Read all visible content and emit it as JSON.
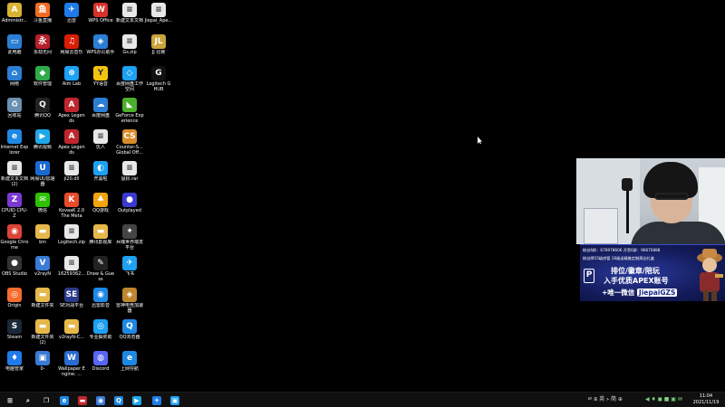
{
  "desktop": {
    "icons": [
      {
        "label": "Administr...",
        "glyph": "A",
        "color": "#d9b233"
      },
      {
        "label": "此电脑",
        "glyph": "▭",
        "color": "#2a7fd4"
      },
      {
        "label": "网络",
        "glyph": "⌂",
        "color": "#2a7fd4"
      },
      {
        "label": "回收站",
        "glyph": "♻",
        "color": "#6a8fb0"
      },
      {
        "label": "Internet Explorer",
        "glyph": "e",
        "color": "#1e88e5"
      },
      {
        "label": "新建文本文档 (2)",
        "glyph": "≡",
        "color": "#e8e8e8"
      },
      {
        "label": "CPUID CPU-Z",
        "glyph": "Z",
        "color": "#7a3ad1"
      },
      {
        "label": "Google Chrome",
        "glyph": "◉",
        "color": "#db4437"
      },
      {
        "label": "OBS Studio",
        "glyph": "●",
        "color": "#333333"
      },
      {
        "label": "Origin",
        "glyph": "◎",
        "color": "#f56c2d"
      },
      {
        "label": "Steam",
        "glyph": "S",
        "color": "#1b2838"
      },
      {
        "label": "电脑管家",
        "glyph": "♦",
        "color": "#1e7be8"
      },
      {
        "label": "斗鱼直播",
        "glyph": "鱼",
        "color": "#f26b21"
      },
      {
        "label": "永劫无间",
        "glyph": "永",
        "color": "#b5202a"
      },
      {
        "label": "软件管理",
        "glyph": "◆",
        "color": "#2eaa4a"
      },
      {
        "label": "腾讯QQ",
        "glyph": "Q",
        "color": "#222222"
      },
      {
        "label": "腾讯视频",
        "glyph": "▶",
        "color": "#1fa7e9"
      },
      {
        "label": "网易UU加速器",
        "glyph": "U",
        "color": "#1a6ad1"
      },
      {
        "label": "微信",
        "glyph": "✉",
        "color": "#2dc100"
      },
      {
        "label": "bin",
        "glyph": "▬",
        "color": "#e6b84a"
      },
      {
        "label": "v2rayN",
        "glyph": "V",
        "color": "#3a7bd5"
      },
      {
        "label": "新建文件夹",
        "glyph": "▬",
        "color": "#e6b84a"
      },
      {
        "label": "新建文件夹 (2)",
        "glyph": "▬",
        "color": "#e6b84a"
      },
      {
        "label": "0-",
        "glyph": "▣",
        "color": "#3a7bd5"
      },
      {
        "label": "迅雷",
        "glyph": "✈",
        "color": "#1e7be8"
      },
      {
        "label": "网易云音乐",
        "glyph": "♫",
        "color": "#d81e06"
      },
      {
        "label": "Aim Lab",
        "glyph": "⊕",
        "color": "#1da1f2"
      },
      {
        "label": "Apex Legends",
        "glyph": "A",
        "color": "#c0262d"
      },
      {
        "label": "Apex Legends",
        "glyph": "A",
        "color": "#c0262d"
      },
      {
        "label": "ji20.dll",
        "glyph": "≡",
        "color": "#e8e8e8"
      },
      {
        "label": "KovaaK 2.0 The Meta",
        "glyph": "K",
        "color": "#e84a2a"
      },
      {
        "label": "Logitech.zip",
        "glyph": "≡",
        "color": "#e8e8e8"
      },
      {
        "label": "16259362...",
        "glyph": "≡",
        "color": "#e8e8e8"
      },
      {
        "label": "SE对战平台",
        "glyph": "SE",
        "color": "#2a3a8a"
      },
      {
        "label": "v2rayN-C...",
        "glyph": "▬",
        "color": "#e6b84a"
      },
      {
        "label": "Wallpaper Engine: ...",
        "glyph": "W",
        "color": "#2a6bd1"
      },
      {
        "label": "WPS Office",
        "glyph": "W",
        "color": "#d6322a"
      },
      {
        "label": "WPS办公助手",
        "glyph": "◈",
        "color": "#2a7fd4"
      },
      {
        "label": "YY语音",
        "glyph": "Y",
        "color": "#f2c40f"
      },
      {
        "label": "百度网盘",
        "glyph": "☁",
        "color": "#2a7fd4"
      },
      {
        "label": "仇人",
        "glyph": "≡",
        "color": "#e8e8e8"
      },
      {
        "label": "开黑啦",
        "glyph": "◐",
        "color": "#1da1f2"
      },
      {
        "label": "QQ游戏",
        "glyph": "♣",
        "color": "#f2a40f"
      },
      {
        "label": "腾讯影视库",
        "glyph": "▬",
        "color": "#e6b84a"
      },
      {
        "label": "Draw & Guess",
        "glyph": "✎",
        "color": "#222222"
      },
      {
        "label": "迅雷影音",
        "glyph": "◉",
        "color": "#1e88e5"
      },
      {
        "label": "专业抽奖助",
        "glyph": "◎",
        "color": "#1da1f2"
      },
      {
        "label": "Discord",
        "glyph": "◍",
        "color": "#5865f2"
      },
      {
        "label": "新建文本文档",
        "glyph": "≡",
        "color": "#e8e8e8"
      },
      {
        "label": "Gs.zip",
        "glyph": "≡",
        "color": "#e8e8e8"
      },
      {
        "label": "百度网盘工作空间",
        "glyph": "◇",
        "color": "#1da1f2"
      },
      {
        "label": "GeForce Experience",
        "glyph": "◣",
        "color": "#4caf2a"
      },
      {
        "label": "Counter-S... Global Off...",
        "glyph": "CS",
        "color": "#d98c2a"
      },
      {
        "label": "鼠标.rar",
        "glyph": "≡",
        "color": "#e8e8e8"
      },
      {
        "label": "Outplayed",
        "glyph": "●",
        "color": "#3a3ad1"
      },
      {
        "label": "兵魂世界端发平台",
        "glyph": "✦",
        "color": "#444444"
      },
      {
        "label": "飞书",
        "glyph": "✈",
        "color": "#1da1f2"
      },
      {
        "label": "雷神电竞加速器",
        "glyph": "◈",
        "color": "#c0862d"
      },
      {
        "label": "QQ浏览器",
        "glyph": "Q",
        "color": "#1e88e5"
      },
      {
        "label": "上网导航",
        "glyph": "e",
        "color": "#1e88e5"
      },
      {
        "label": "Jiepai_Ape...",
        "glyph": "≡",
        "color": "#e8e8e8"
      },
      {
        "label": "JJ 比赛",
        "glyph": "JL",
        "color": "#c9a53a"
      },
      {
        "label": "Logitech G HUB",
        "glyph": "G",
        "color": "#111111"
      }
    ]
  },
  "promo": {
    "row1": "粉丝6群：676978606  开黑6群：96670888",
    "row2": "粉丝牌15级房管  16级送精美定制周边礼盒",
    "line1": "排位/徽章/陪玩",
    "line2": "入手优质APEX账号",
    "line3_prefix": "+唯一微信",
    "line3_id": "JiepaiGZS",
    "logo": "P"
  },
  "taskbar": {
    "apps": [
      {
        "name": "start-button",
        "glyph": "⊞",
        "color": "#101010"
      },
      {
        "name": "search-button",
        "glyph": "⌕",
        "color": "#101010"
      },
      {
        "name": "task-view-button",
        "glyph": "❐",
        "color": "#101010"
      },
      {
        "name": "taskbar-ie",
        "glyph": "e",
        "color": "#1e88e5"
      },
      {
        "name": "taskbar-app-red",
        "glyph": "▬",
        "color": "#c0262d"
      },
      {
        "name": "taskbar-app-round",
        "glyph": "◉",
        "color": "#3a7bd5"
      },
      {
        "name": "taskbar-qq-browser",
        "glyph": "Q",
        "color": "#1e88e5"
      },
      {
        "name": "taskbar-tencent-video",
        "glyph": "▶",
        "color": "#1fa7e9"
      },
      {
        "name": "taskbar-xunlei",
        "glyph": "✈",
        "color": "#1e7be8"
      },
      {
        "name": "taskbar-app-active",
        "glyph": "▣",
        "color": "#1da1f2"
      }
    ],
    "tray": {
      "items": "ㄹ ⧈ 英 ᚛ 简 ⊕",
      "icons": "◀ ♦ ◼ ■ ▣ ✉"
    },
    "clock": {
      "time": "11:04",
      "date": "2021/11/19"
    }
  }
}
